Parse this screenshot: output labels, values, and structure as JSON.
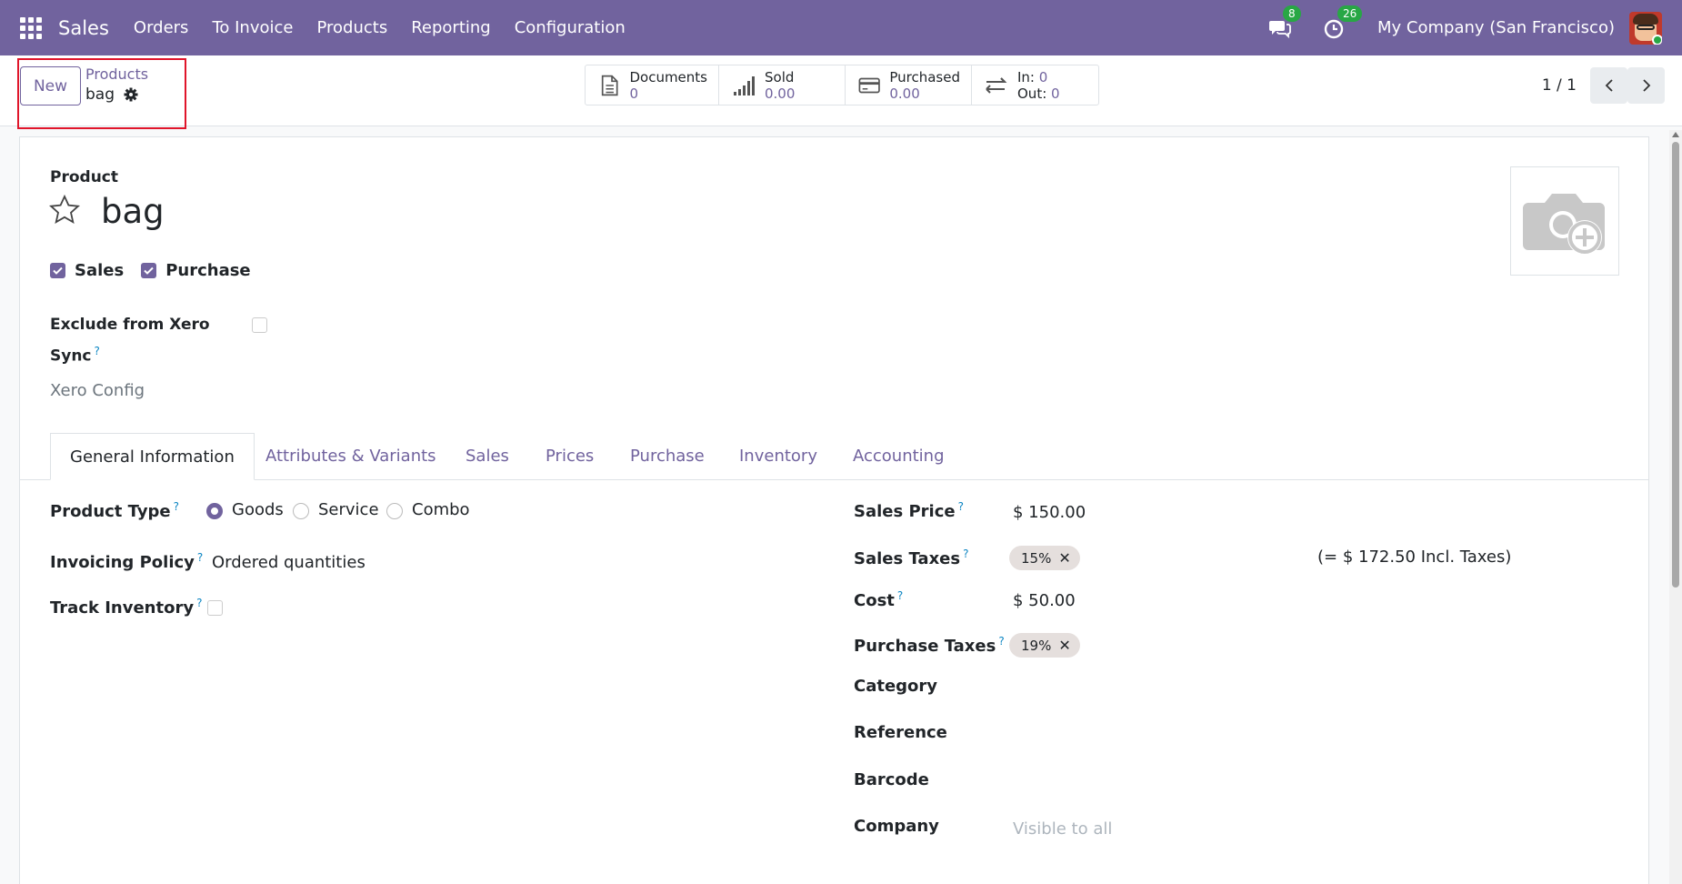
{
  "navbar": {
    "app_name": "Sales",
    "menu": [
      "Orders",
      "To Invoice",
      "Products",
      "Reporting",
      "Configuration"
    ],
    "messages_count": "8",
    "activities_count": "26",
    "company": "My Company (San Francisco)"
  },
  "control_panel": {
    "new_label": "New",
    "breadcrumb_parent": "Products",
    "breadcrumb_current": "bag",
    "pager": "1 / 1"
  },
  "smart_buttons": {
    "documents": {
      "label": "Documents",
      "value": "0"
    },
    "sold": {
      "label": "Sold",
      "value": "0.00"
    },
    "purchased": {
      "label": "Purchased",
      "value": "0.00"
    },
    "in_out": {
      "in_label": "In:",
      "in_value": "0",
      "out_label": "Out:",
      "out_value": "0"
    }
  },
  "form": {
    "product_label": "Product",
    "product_name": "bag",
    "sales_label": "Sales",
    "sales_checked": true,
    "purchase_label": "Purchase",
    "purchase_checked": true,
    "exclude_xero_line1": "Exclude from Xero",
    "exclude_xero_line2": "Sync",
    "exclude_xero_checked": false,
    "xero_config": "Xero Config"
  },
  "tabs": [
    "General Information",
    "Attributes & Variants",
    "Sales",
    "Prices",
    "Purchase",
    "Inventory",
    "Accounting"
  ],
  "active_tab": "General Information",
  "general": {
    "product_type_label": "Product Type",
    "product_type_options": [
      "Goods",
      "Service",
      "Combo"
    ],
    "product_type_selected": "Goods",
    "invoicing_policy_label": "Invoicing Policy",
    "invoicing_policy_value": "Ordered quantities",
    "track_inventory_label": "Track Inventory",
    "track_inventory_checked": false,
    "sales_price_label": "Sales Price",
    "sales_price_value": "$ 150.00",
    "sales_taxes_label": "Sales Taxes",
    "sales_taxes_tag": "15%",
    "sales_taxes_incl": "(= $ 172.50 Incl. Taxes)",
    "cost_label": "Cost",
    "cost_value": "$ 50.00",
    "purchase_taxes_label": "Purchase Taxes",
    "purchase_taxes_tag": "19%",
    "category_label": "Category",
    "reference_label": "Reference",
    "barcode_label": "Barcode",
    "company_label": "Company",
    "company_placeholder": "Visible to all"
  },
  "help_marker": "?",
  "colors": {
    "brand": "#71639e",
    "badge": "#28a745",
    "highlight": "#e0152a"
  }
}
